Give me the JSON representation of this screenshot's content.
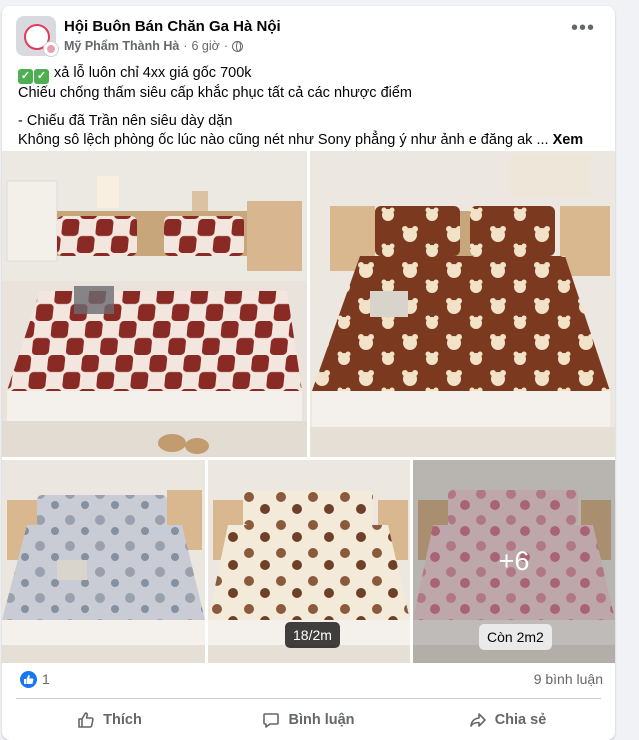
{
  "post": {
    "group_name": "Hội Buôn Bán Chăn Ga Hà Nội",
    "author": "Mỹ Phẩm Thành Hà",
    "time": "6 giờ",
    "more_label": "•••",
    "lines": {
      "line1": "xả lỗ luôn chỉ 4xx giá gốc 700k",
      "line2": "Chiếu chống thấm siêu cấp khắc phục tất cả các nhược điểm",
      "line3": "- Chiếu đã Trần nên siêu dày dặn",
      "line4": "Không sô lệch phòng ốc lúc nào cũng nét như Sony phẳng ý như ảnh e đăng ak ...",
      "see_more": "Xem thêm"
    },
    "check_icon": "✓"
  },
  "photos": {
    "tag_size": "18/2m",
    "tag_left": "Còn 2m2",
    "more_count": "+6"
  },
  "stats": {
    "likes": "1",
    "comments": "9 bình luận"
  },
  "actions": {
    "like": "Thích",
    "comment": "Bình luận",
    "share": "Chia sẻ"
  },
  "colors": {
    "accent": "#1877f2",
    "text": "#050505",
    "secondary": "#65676b"
  }
}
